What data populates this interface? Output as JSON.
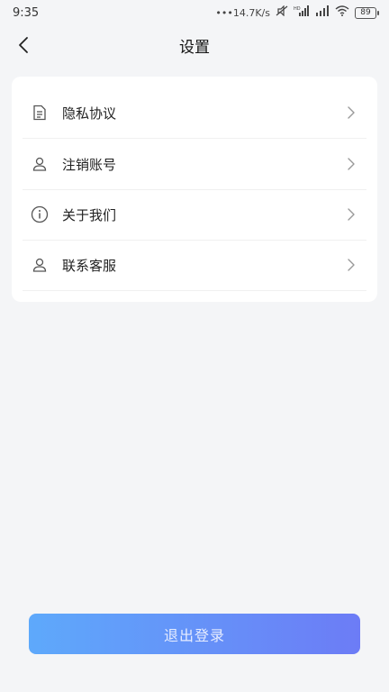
{
  "status_bar": {
    "time": "9:35",
    "network_speed": "•••14.7K/s",
    "signal_label": "HD",
    "battery": "89"
  },
  "header": {
    "title": "设置",
    "back_icon": "chevron-left-icon"
  },
  "settings": {
    "items": [
      {
        "label": "隐私协议",
        "icon": "document-icon"
      },
      {
        "label": "注销账号",
        "icon": "user-icon"
      },
      {
        "label": "关于我们",
        "icon": "info-icon"
      },
      {
        "label": "联系客服",
        "icon": "user-icon"
      }
    ]
  },
  "logout": {
    "label": "退出登录"
  },
  "colors": {
    "background": "#f4f5f7",
    "gradient_start": "#5ea9fb",
    "gradient_end": "#6c7cf6"
  }
}
